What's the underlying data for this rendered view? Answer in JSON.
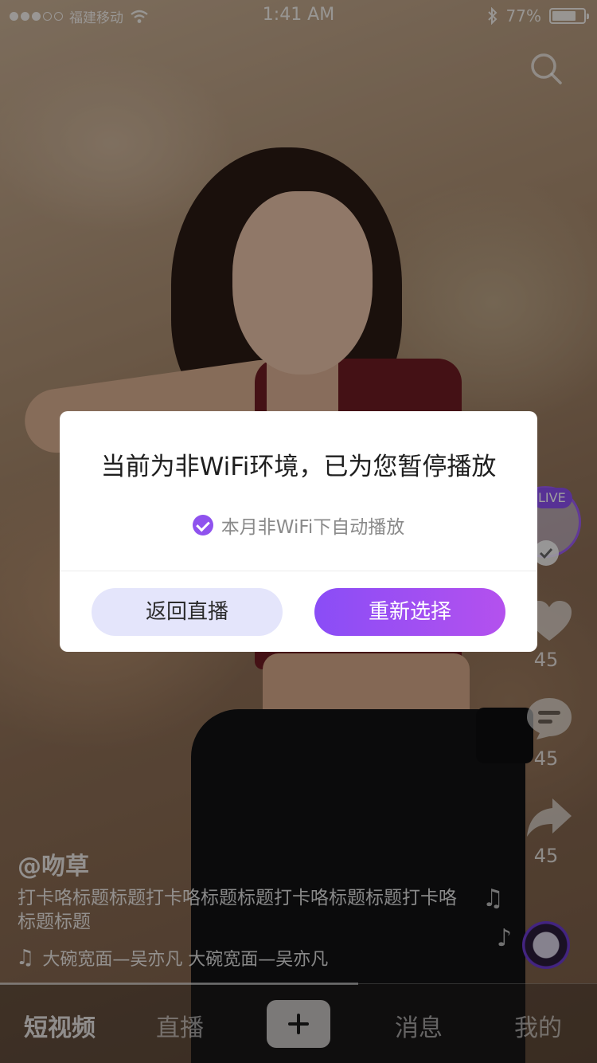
{
  "status_bar": {
    "carrier": "福建移动",
    "time": "1:41 AM",
    "battery": "77%",
    "battery_level": 0.77
  },
  "dialog": {
    "title": "当前为非WiFi环境，已为您暂停播放",
    "option_label": "本月非WiFi下自动播放",
    "option_checked": true,
    "back_button": "返回直播",
    "reselect_button": "重新选择"
  },
  "side_actions": {
    "live_badge": "LIVE",
    "like_count": "45",
    "comment_count": "45",
    "share_count": "45"
  },
  "video_info": {
    "username": "@吻草",
    "caption": "打卡咯标题标题打卡咯标题标题打卡咯标题标题打卡咯标题标题",
    "music": "大碗宽面—吴亦凡  大碗宽面—吴亦凡"
  },
  "tab_bar": {
    "tabs": [
      "短视频",
      "直播",
      "消息",
      "我的"
    ],
    "active_index": 0
  },
  "colors": {
    "accent": "#8d4ff0",
    "button_secondary_bg": "#e4e5fb"
  },
  "icons": [
    "search-icon",
    "wifi-icon",
    "bluetooth-icon",
    "heart-icon",
    "comment-icon",
    "share-icon",
    "music-note-icon",
    "plus-icon",
    "check-icon"
  ]
}
